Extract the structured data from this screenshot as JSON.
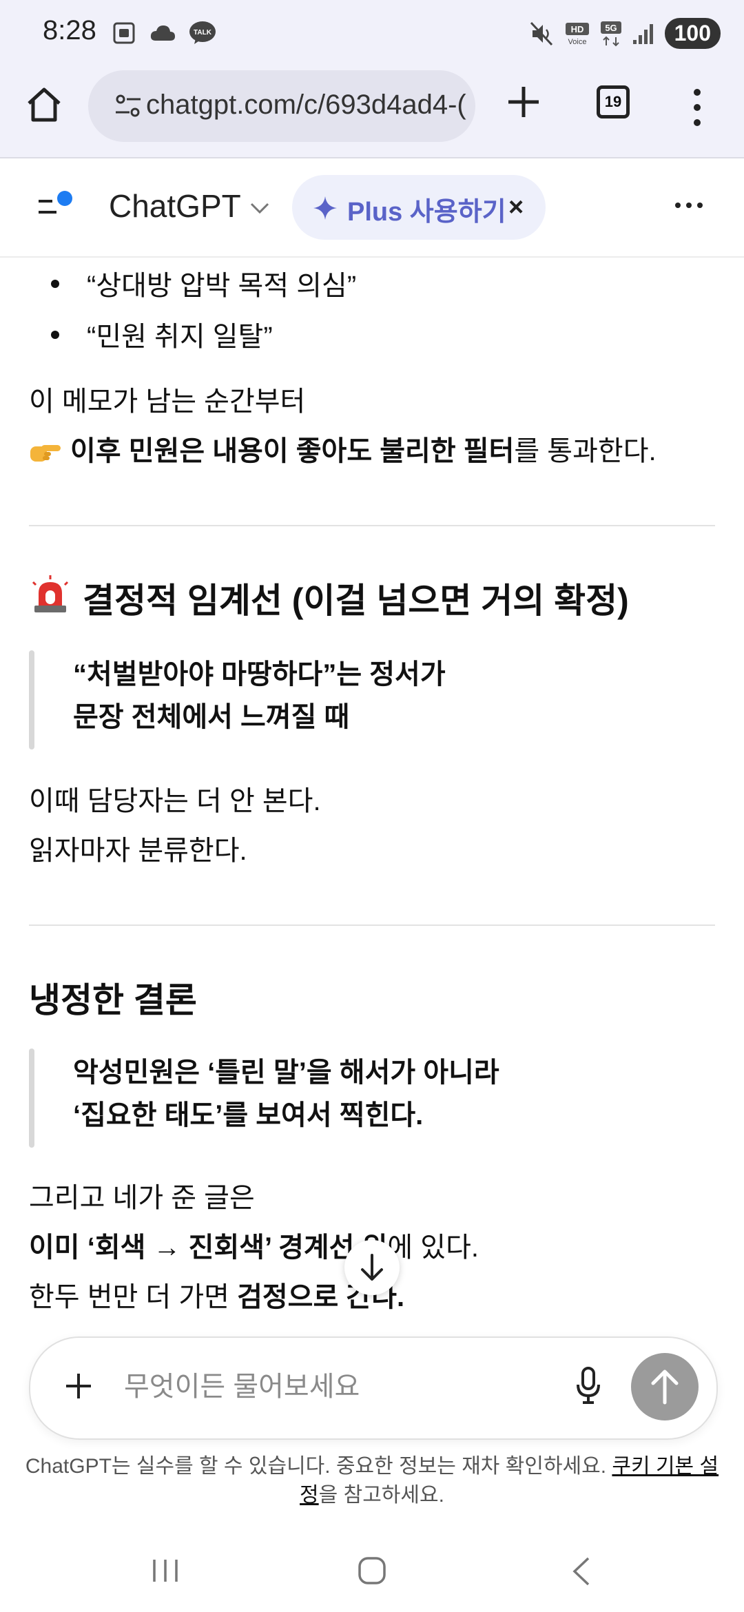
{
  "status_bar": {
    "time": "8:28",
    "left_icons": [
      "screenshot-icon",
      "cloud-icon",
      "talk-icon"
    ],
    "talk_badge": "TALK",
    "right_icons": [
      "mute-icon",
      "hd-voice-icon",
      "5g-icon",
      "signal-icon"
    ],
    "hd_label": "HD",
    "voice_label": "Voice",
    "network": "5G",
    "battery": "100"
  },
  "browser": {
    "url": "chatgpt.com/c/693d4ad4-(",
    "tab_count": "19"
  },
  "header": {
    "title": "ChatGPT",
    "plus_label": "Plus 사용하기",
    "close_glyph": "×"
  },
  "content": {
    "bullets": [
      "“상대방 압박 목적 의심”",
      "“민원 취지 일탈”"
    ],
    "para1_line1": "이 메모가 남는 순간부터",
    "para1_line2_bold": "이후 민원은 내용이 좋아도 불리한 필터",
    "para1_line2_rest": "를 통과한다.",
    "section1_heading": "결정적 임계선 (이걸 넘으면 거의 확정)",
    "section1_quote": [
      "“처벌받아야 마땅하다”는 정서가",
      "문장 전체에서 느껴질 때"
    ],
    "section1_lines": [
      "이때 담당자는 더 안 본다.",
      "읽자마자 분류한다."
    ],
    "section2_heading": "냉정한 결론",
    "section2_quote": [
      "악성민원은 ‘틀린 말’을 해서가 아니라",
      "‘집요한 태도’를 보여서 찍힌다."
    ],
    "final_line1": "그리고 네가 준 글은",
    "final_line2_bold": "이미 ‘회색 → 진회색’ 경계선 위",
    "final_line2_rest": "에 있다.",
    "final_line3_pre": "한두 번만 더 가면 ",
    "final_line3_bold": "검정으로 간다."
  },
  "composer": {
    "placeholder": "무엇이든 물어보세요"
  },
  "disclaimer": {
    "text": "ChatGPT는 실수를 할 수 있습니다. 중요한 정보는 재차 확인하세요. ",
    "link": "쿠키 기본 설정",
    "suffix": "을 참고하세요."
  }
}
